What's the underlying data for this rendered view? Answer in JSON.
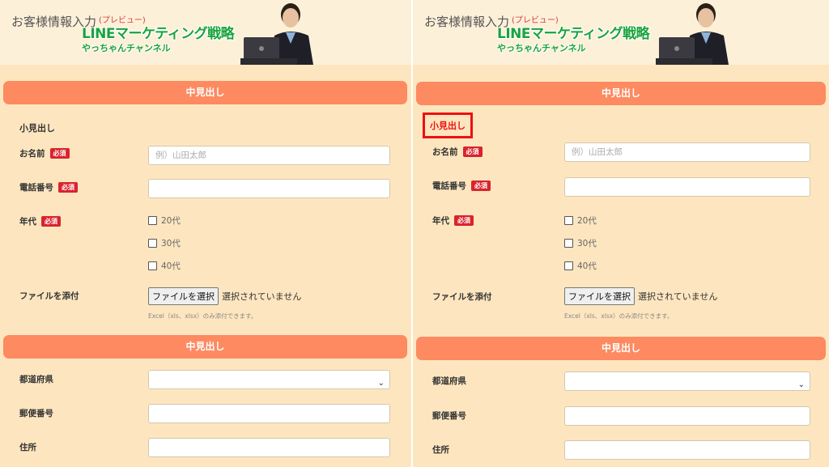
{
  "header": {
    "title": "お客様情報入力",
    "preview_tag": "(プレビュー)",
    "banner_title": "LINEマーケティング戦略",
    "banner_sub": "やっちゃんチャンネル"
  },
  "form": {
    "section_heading_1": "中見出し",
    "small_heading": "小見出し",
    "required_badge": "必須",
    "name_label": "お名前",
    "name_placeholder": "例）山田太郎",
    "phone_label": "電話番号",
    "age_label": "年代",
    "age_options": [
      "20代",
      "30代",
      "40代"
    ],
    "file_label": "ファイルを添付",
    "file_button": "ファイルを選択",
    "file_status": "選択されていません",
    "file_note": "Excel（xls、xlsx）のみ添付できます。",
    "section_heading_2": "中見出し",
    "prefecture_label": "都道府県",
    "postal_label": "郵便番号",
    "address_label": "住所"
  },
  "colors": {
    "page_bg": "#fde6bf",
    "header_bg": "#fdf0d9",
    "section_bar": "#fd8a60",
    "required_badge": "#d9232d",
    "highlight_border": "#ee1010",
    "brand_green": "#1aa33c"
  }
}
